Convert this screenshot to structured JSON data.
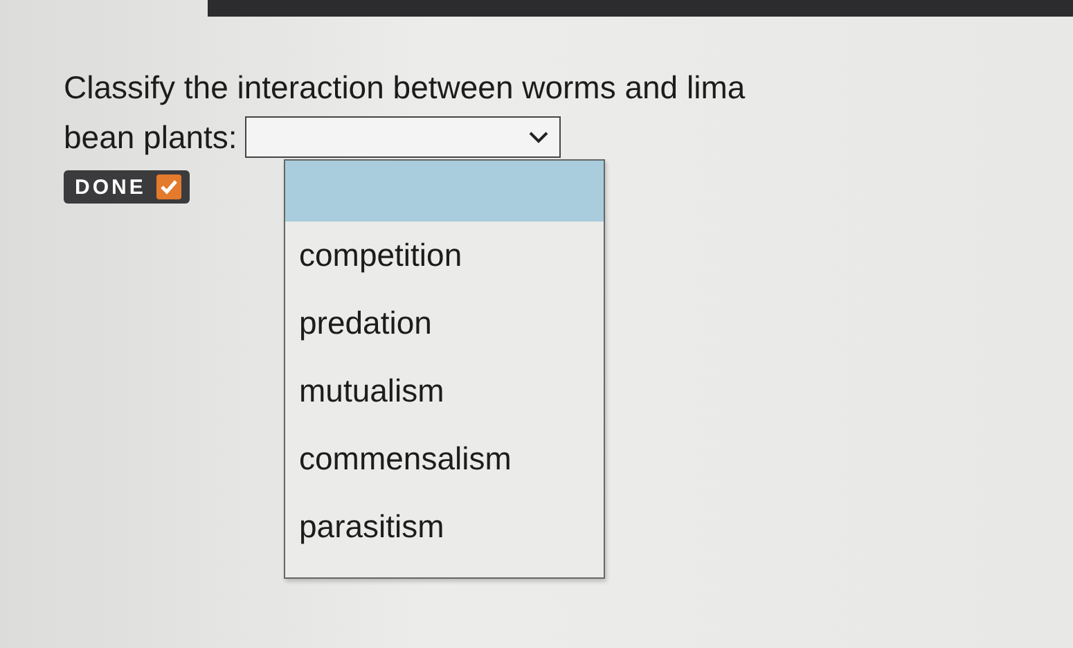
{
  "question": {
    "lines": [
      "Classify the interaction between worms and lima",
      "bean plants:"
    ]
  },
  "done_button": {
    "label": "DONE",
    "checked": true
  },
  "dropdown": {
    "expanded": true,
    "blank_highlighted": true,
    "options": [
      {
        "label": "competition",
        "selected": false
      },
      {
        "label": "predation",
        "selected": false
      },
      {
        "label": "mutualism",
        "selected": false
      },
      {
        "label": "commensalism",
        "selected": false
      },
      {
        "label": "parasitism",
        "selected": false
      }
    ]
  }
}
